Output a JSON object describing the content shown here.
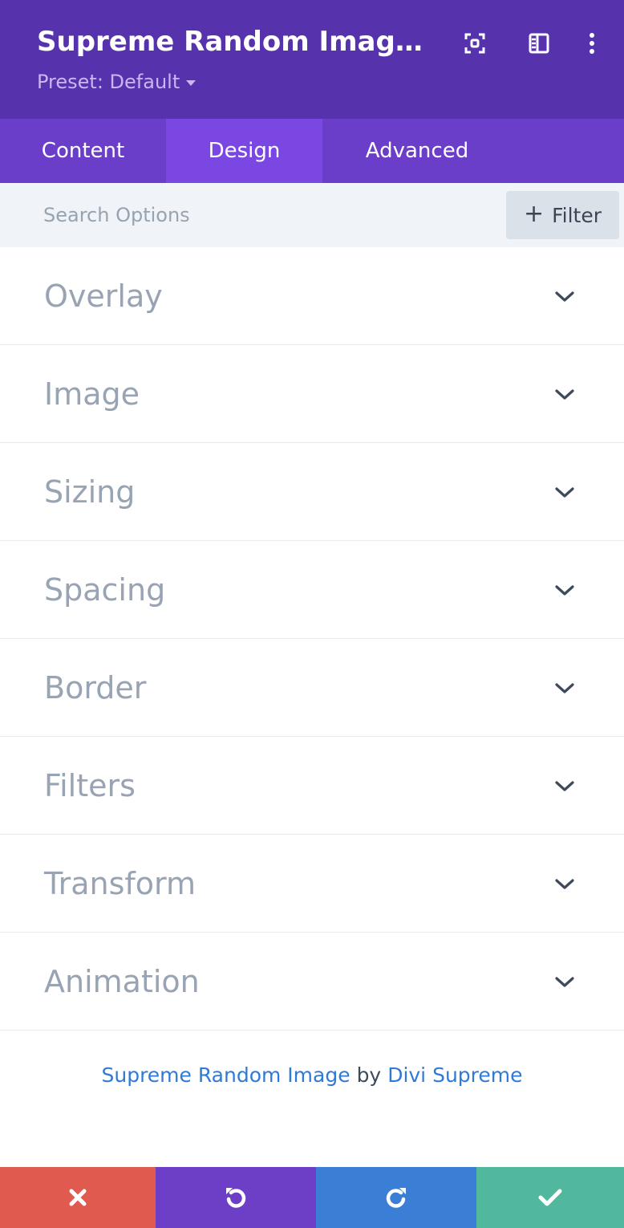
{
  "header": {
    "title": "Supreme Random Image S...",
    "preset_label": "Preset: Default",
    "icons": [
      "focus-icon",
      "sidebar-layout-icon",
      "more-vertical-icon"
    ]
  },
  "tabs": [
    {
      "label": "Content",
      "active": false
    },
    {
      "label": "Design",
      "active": true
    },
    {
      "label": "Advanced",
      "active": false
    }
  ],
  "search": {
    "placeholder": "Search Options",
    "value": "",
    "filter_label": "Filter"
  },
  "sections": [
    {
      "label": "Overlay"
    },
    {
      "label": "Image"
    },
    {
      "label": "Sizing"
    },
    {
      "label": "Spacing"
    },
    {
      "label": "Border"
    },
    {
      "label": "Filters"
    },
    {
      "label": "Transform"
    },
    {
      "label": "Animation"
    }
  ],
  "credit": {
    "module": "Supreme Random Image",
    "by": "by",
    "author": "Divi Supreme"
  },
  "footer": {
    "buttons": [
      {
        "name": "discard",
        "icon": "close-icon",
        "color": "#e05a50"
      },
      {
        "name": "undo",
        "icon": "undo-icon",
        "color": "#6c3fc6"
      },
      {
        "name": "redo",
        "icon": "redo-icon",
        "color": "#3a7fd5"
      },
      {
        "name": "save",
        "icon": "check-icon",
        "color": "#52b89d"
      }
    ]
  },
  "colors": {
    "header_bg": "#5632ad",
    "tabs_bg": "#6b3ec9",
    "tab_active_bg": "#7b47e3",
    "link": "#2f7ad6"
  }
}
